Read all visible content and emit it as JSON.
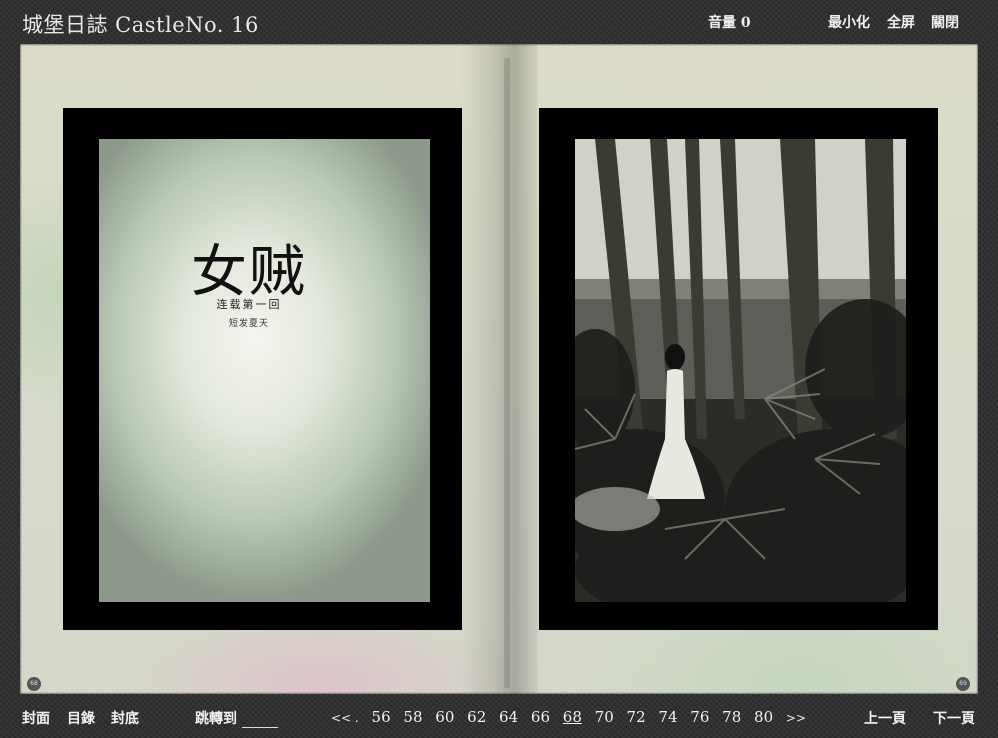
{
  "header": {
    "title": "城堡日誌 CastleNo. 16",
    "volume_label": "音量 0",
    "minimize_label": "最小化",
    "fullscreen_label": "全屏",
    "close_label": "關閉"
  },
  "left_page": {
    "title": "女贼",
    "subtitle": "连载第一回",
    "author": "短发夏天",
    "page_number": "68"
  },
  "right_page": {
    "page_number": "69"
  },
  "footer": {
    "cover_label": "封面",
    "toc_label": "目錄",
    "back_cover_label": "封底",
    "jump_label": "跳轉到",
    "prev_arrow": "<< .",
    "next_arrow": ">>",
    "pages": [
      "56",
      "58",
      "60",
      "62",
      "64",
      "66",
      "68",
      "70",
      "72",
      "74",
      "76",
      "78",
      "80"
    ],
    "current_page": "68",
    "prev_page_label": "上一頁",
    "next_page_label": "下一頁"
  },
  "colors": {
    "background": "#2a2a2a",
    "paper": "#dcdcc8",
    "frame": "#000000"
  }
}
